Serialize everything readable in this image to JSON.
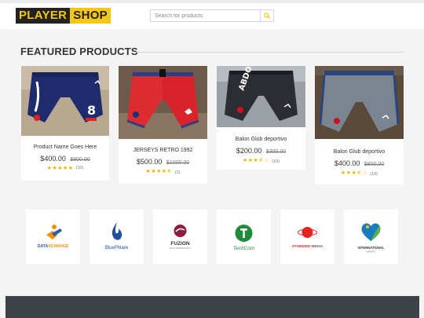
{
  "header": {
    "logo_part1": "PLAYER",
    "logo_part2": "SHOP",
    "search_placeholder": "Search for products",
    "search_icon": "search-icon"
  },
  "featured": {
    "title": "FEATURED PRODUCTS",
    "products": [
      {
        "name": "Product Name Goes Here",
        "price": "$400.00",
        "old_price": "$800.00",
        "rating": 5,
        "stars": "★★★★★",
        "reviews": "(10)"
      },
      {
        "name": "JERSEYS RETRO 1992",
        "price": "$500.00",
        "old_price": "$1000.00",
        "rating": 4.5,
        "stars": "★★★★⯪",
        "reviews": "(2)"
      },
      {
        "name": "Balon Glub deportivo",
        "price": "$200.00",
        "old_price": "$300.00",
        "rating": 3.5,
        "stars": "★★★⯪☆",
        "reviews": "(19)"
      },
      {
        "name": "Balon Glub deportivo",
        "price": "$400.00",
        "old_price": "$800.00",
        "rating": 3.5,
        "stars": "★★★⯪☆",
        "reviews": "(19)"
      }
    ]
  },
  "brands": [
    {
      "part1": "DATA",
      "part2": "XCHANGE",
      "sub": ""
    },
    {
      "part1": "BluePhlare",
      "part2": "",
      "sub": ""
    },
    {
      "part1": "FUZION",
      "part2": "",
      "sub": "FLUX.TECHNOLOGY"
    },
    {
      "part1": "TechCom",
      "part2": "",
      "sub": ""
    },
    {
      "part1": "ATOMIZED",
      "part2": "MEDIA",
      "sub": ""
    },
    {
      "part1": "INTERNATIONAL",
      "part2": "",
      "sub": "HEARTS"
    }
  ],
  "colors": {
    "accent": "#f5c518",
    "dark": "#222222",
    "star": "#e8b400",
    "footer": "#3d4148"
  }
}
